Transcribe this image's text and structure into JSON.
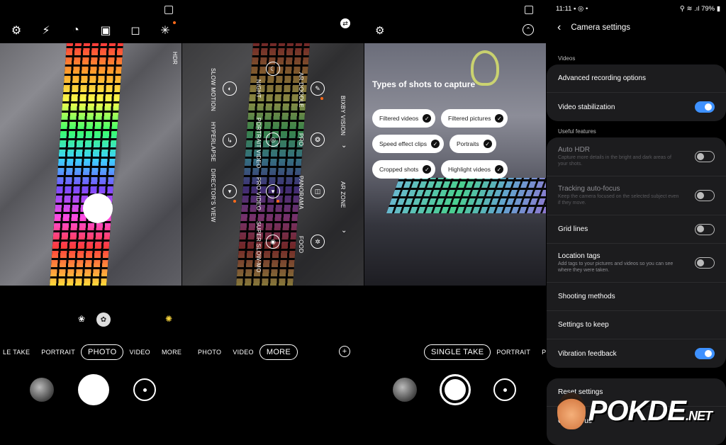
{
  "panel1": {
    "top_icons": [
      "gear-icon",
      "flash-off-icon",
      "timer-icon",
      "ratio-icon",
      "motion-photo-icon",
      "filter-icon"
    ],
    "hdr_label": "HDR",
    "modes": [
      {
        "label": "LE TAKE",
        "active": false
      },
      {
        "label": "PORTRAIT",
        "active": false
      },
      {
        "label": "PHOTO",
        "active": true
      },
      {
        "label": "VIDEO",
        "active": false
      },
      {
        "label": "MORE",
        "active": false
      }
    ]
  },
  "panel2": {
    "modes_grid": [
      {
        "label": "SLOW MOTION"
      },
      {
        "label": "HYPERLAPSE"
      },
      {
        "label": "DIRECTOR'S VIEW"
      },
      {
        "label": "NIGHT"
      },
      {
        "label": "PORTRAIT VIDEO"
      },
      {
        "label": "PRO VIDEO"
      },
      {
        "label": "SUPER SLOW-MO"
      },
      {
        "label": "AR DOODLE"
      },
      {
        "label": "PRO"
      },
      {
        "label": "PANORAMA"
      },
      {
        "label": "FOOD"
      },
      {
        "label": "BIXBY VISION"
      },
      {
        "label": "AR ZONE"
      }
    ],
    "bottom_modes": [
      {
        "label": "PHOTO",
        "active": false
      },
      {
        "label": "VIDEO",
        "active": false
      },
      {
        "label": "MORE",
        "active": true
      }
    ],
    "add_label": "+"
  },
  "panel3": {
    "chips_title": "Types of shots to capture",
    "chips": [
      "Filtered videos",
      "Filtered pictures",
      "Speed effect clips",
      "Portraits",
      "Cropped shots",
      "Highlight videos"
    ],
    "modes": [
      {
        "label": "SINGLE TAKE",
        "active": true
      },
      {
        "label": "PORTRAIT",
        "active": false
      },
      {
        "label": "PHOT",
        "active": false
      }
    ]
  },
  "panel4": {
    "status": {
      "time": "11:11",
      "battery": "79%"
    },
    "title": "Camera settings",
    "sections": [
      {
        "label": "Videos",
        "rows": [
          {
            "title": "Advanced recording options",
            "desc": "",
            "toggle": null,
            "dim": false
          },
          {
            "title": "Video stabilization",
            "desc": "",
            "toggle": true,
            "dim": false
          }
        ]
      },
      {
        "label": "Useful features",
        "rows": [
          {
            "title": "Auto HDR",
            "desc": "Capture more details in the bright and dark areas of your shots.",
            "toggle": false,
            "dim": true
          },
          {
            "title": "Tracking auto-focus",
            "desc": "Keep the camera focused on the selected subject even if they move.",
            "toggle": false,
            "dim": true
          },
          {
            "title": "Grid lines",
            "desc": "",
            "toggle": false,
            "dim": false
          },
          {
            "title": "Location tags",
            "desc": "Add tags to your pictures and videos so you can see where they were taken.",
            "toggle": false,
            "dim": false
          },
          {
            "title": "Shooting methods",
            "desc": "",
            "toggle": null,
            "dim": false
          },
          {
            "title": "Settings to keep",
            "desc": "",
            "toggle": null,
            "dim": false
          },
          {
            "title": "Vibration feedback",
            "desc": "",
            "toggle": true,
            "dim": false
          }
        ]
      }
    ],
    "bottom_rows": [
      "Reset settings",
      "Contact us"
    ],
    "watermark": {
      "text": "POKDE",
      "suffix": ".NET"
    }
  },
  "colors": {
    "accent": "#3e91ff",
    "dot": "#ff6a1a",
    "card": "#1c1c1e"
  }
}
